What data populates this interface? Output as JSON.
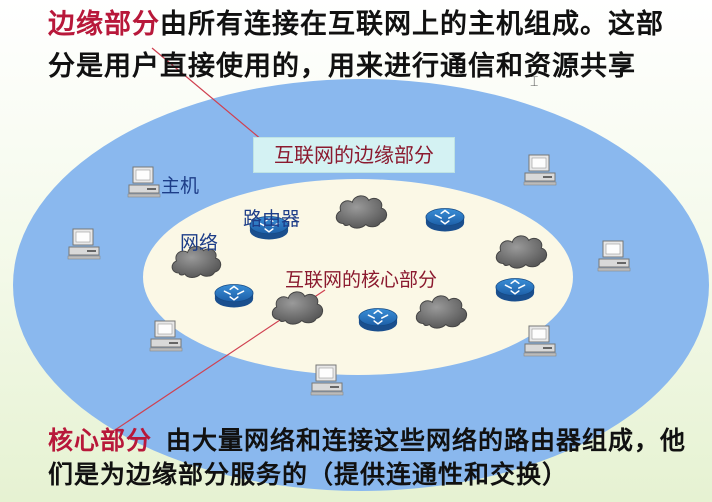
{
  "intro": {
    "edge_term": "边缘部分",
    "edge_text": "由所有连接在互联网上的主机组成。这部分是用户直接使用的，用来进行通信和资源共享"
  },
  "diagram": {
    "edge_title": "互联网的边缘部分",
    "core_title": "互联网的核心部分",
    "host_label": "主机",
    "router_label": "路由器",
    "network_label": "网络"
  },
  "summary": {
    "core_term": "核心部分",
    "core_text": "由大量网络和连接这些网络的路由器组成，他们是为边缘部分服务的（提供连通性和交换）"
  },
  "colors": {
    "outer_ring": "#8ab8ee",
    "inner_core": "#fbf8e6",
    "highlight_term": "#b8183a",
    "diagram_label": "#1d3d88",
    "callout_line": "#d04050"
  },
  "icons": {
    "host": "computer-icon",
    "router": "router-icon",
    "network": "cloud-icon"
  }
}
